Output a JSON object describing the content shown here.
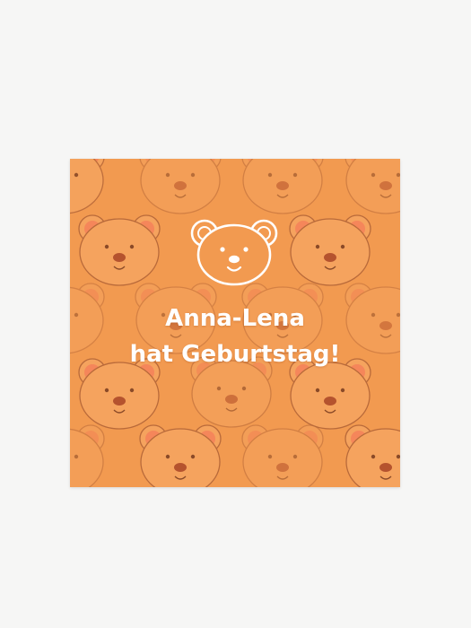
{
  "card": {
    "line1": "Anna-Lena",
    "line2": "hat Geburtstag!"
  },
  "icons": {
    "center": "bear-face-icon",
    "pattern": "bear-face-icon"
  },
  "colors": {
    "page_background": "#f6f6f5",
    "card_background": "#f29a50",
    "bear_face": "#f5a35e",
    "bear_outline": "#b96a3a",
    "bear_ear_inner": "#f47c5a",
    "text": "#ffffff"
  }
}
